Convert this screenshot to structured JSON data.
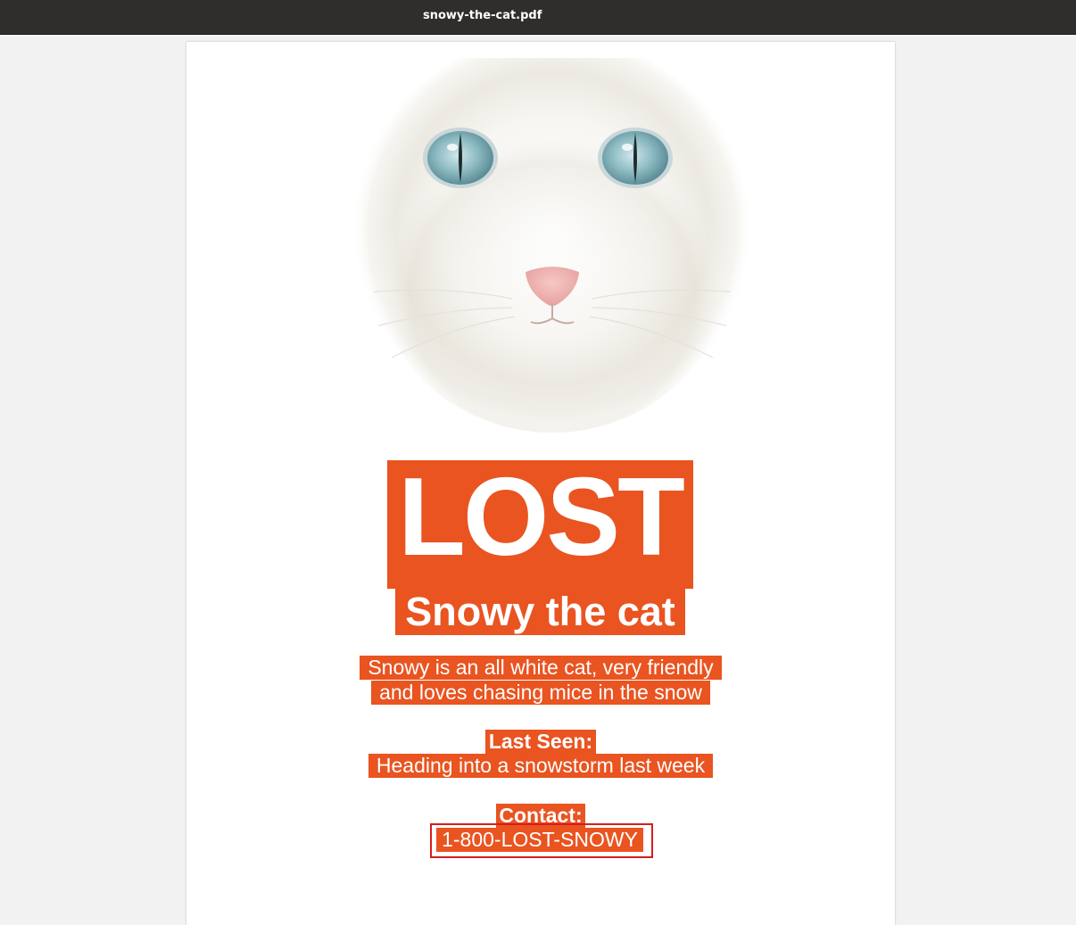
{
  "window": {
    "title": "snowy-the-cat.pdf"
  },
  "document": {
    "image": {
      "description_icon": "white-cat-face-photo"
    },
    "headline": "LOST",
    "subtitle": "Snowy the cat",
    "description_lines": [
      "Snowy is an all white cat, very friendly",
      "and loves chasing mice in the snow"
    ],
    "last_seen_label": "Last Seen:",
    "last_seen_value": "Heading into a snowstorm last week",
    "contact_label": "Contact:",
    "contact_value": "1-800-LOST-SNOWY"
  },
  "colors": {
    "highlight": "#e95420",
    "titlebar": "#2f2e2c",
    "selection_outline": "#d81c1c"
  }
}
